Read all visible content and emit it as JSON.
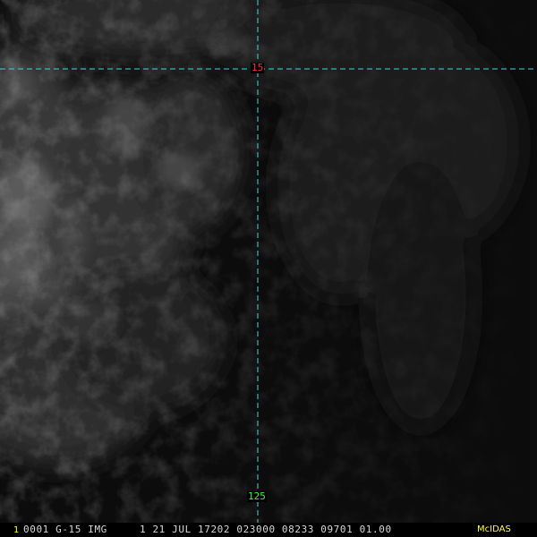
{
  "colors": {
    "graticule": "#3fd9d9",
    "latitude_label": "#ff3030",
    "longitude_label": "#30ff30",
    "status_text": "#d8d8d8",
    "frame_number": "#ffff40",
    "brand": "#ffff40"
  },
  "graticule": {
    "latitude_label": "15",
    "longitude_label": "125"
  },
  "status_bar": {
    "frame_number": "1",
    "header_text": "0001 G-15 IMG     1 21 JUL 17202 023000 08233 09701 01.00",
    "brand": "McIDAS"
  }
}
